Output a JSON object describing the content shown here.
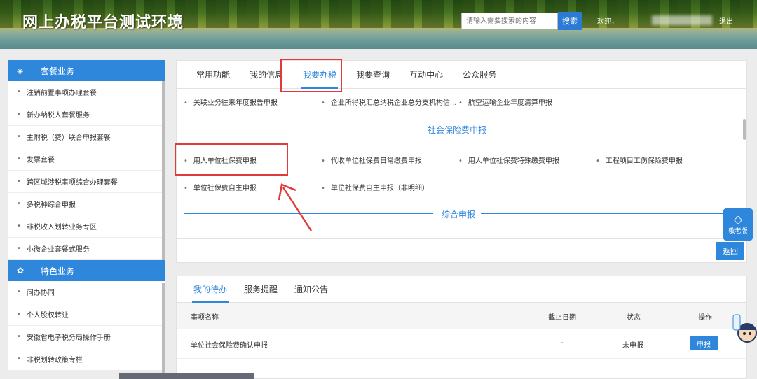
{
  "header": {
    "site_title": "网上办税平台测试环境",
    "search_placeholder": "请输入需要搜索的内容",
    "search_label": "搜索",
    "welcome": "欢迎，",
    "logout": "退出"
  },
  "sidebar": {
    "group1": {
      "title": "套餐业务",
      "items": [
        "注销前置事项办理套餐",
        "新办纳税人套餐服务",
        "主附税（费）联合申报套餐",
        "发票套餐",
        "跨区域涉税事项综合办理套餐",
        "多税种综合申报",
        "非税收入划转业务专区",
        "小微企业套餐式服务"
      ]
    },
    "group2": {
      "title": "特色业务",
      "items": [
        "问办协同",
        "个人股权转让",
        "安徽省电子税务局操作手册",
        "非税划转政策专栏"
      ]
    }
  },
  "main": {
    "tabs": [
      "常用功能",
      "我的信息",
      "我要办税",
      "我要查询",
      "互动中心",
      "公众服务"
    ],
    "row1": [
      "关联业务往来年度报告申报",
      "企业所得税汇总纳税企业总分支机构信...",
      "航空运输企业年度清算申报"
    ],
    "section1": "社会保险费申报",
    "row2": [
      "用人单位社保费申报",
      "代收单位社保费日常缴费申报",
      "用人单位社保费特殊缴费申报",
      "工程项目工伤保险费申报"
    ],
    "row3": [
      "单位社保费自主申报",
      "单位社保费自主申报（非明细）"
    ],
    "section2": "综合申报",
    "back_label": "返回",
    "elder_label": "敬老版"
  },
  "todo": {
    "tabs": [
      "我的待办",
      "服务提醒",
      "通知公告"
    ],
    "columns": [
      "事项名称",
      "截止日期",
      "状态",
      "操作"
    ],
    "rows": [
      {
        "name": "单位社会保险费确认申报",
        "deadline": "-",
        "status": "未申报",
        "action": "申报"
      }
    ]
  },
  "colors": {
    "accent": "#2f87dc",
    "highlight": "#e03a3a"
  }
}
